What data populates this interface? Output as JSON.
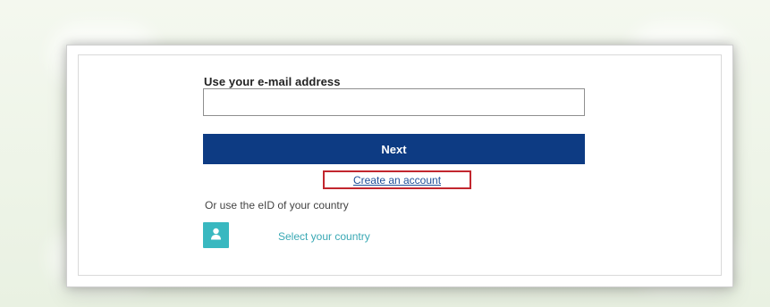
{
  "form": {
    "email_label": "Use your e-mail address",
    "email_value": "",
    "next_label": "Next",
    "create_account_label": "Create an account",
    "eid_text": "Or use the eID of your country",
    "country_label": "Select your country"
  },
  "colors": {
    "page_background": "#eef3e8",
    "next_button": "#0d3b83",
    "highlight_border": "#c2262e",
    "link_blue": "#1f4f99",
    "country_icon": "#39b8c0",
    "country_text": "#39a8b4"
  },
  "icons": {
    "country": "user-icon"
  }
}
